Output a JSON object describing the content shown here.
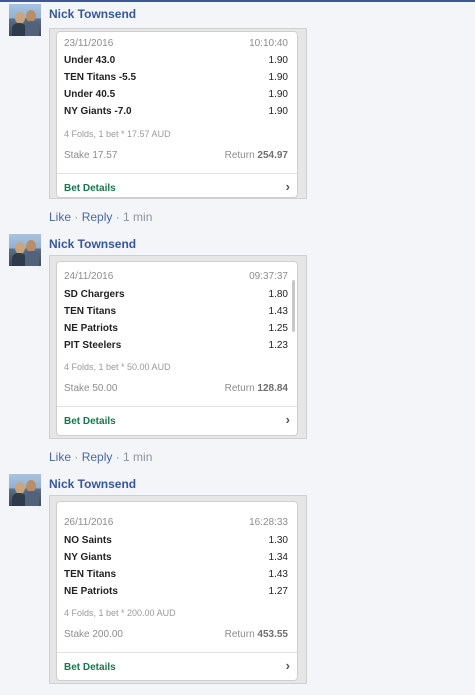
{
  "posts": [
    {
      "author": "Nick Townsend",
      "date": "23/11/2016",
      "time": "10:10:40",
      "legs": [
        {
          "team": "Under 43.0",
          "odds": "1.90"
        },
        {
          "team": "TEN Titans -5.5",
          "odds": "1.90"
        },
        {
          "team": "Under 40.5",
          "odds": "1.90"
        },
        {
          "team": "NY Giants -7.0",
          "odds": "1.90"
        }
      ],
      "summary": "4 Folds, 1 bet * 17.57 AUD",
      "stake": "Stake 17.57",
      "return_label": "Return",
      "return_value": "254.97",
      "details": "Bet Details",
      "like": "Like",
      "reply": "Reply",
      "age": "1 min"
    },
    {
      "author": "Nick Townsend",
      "date": "24/11/2016",
      "time": "09:37:37",
      "legs": [
        {
          "team": "SD Chargers",
          "odds": "1.80"
        },
        {
          "team": "TEN Titans",
          "odds": "1.43"
        },
        {
          "team": "NE Patriots",
          "odds": "1.25"
        },
        {
          "team": "PIT Steelers",
          "odds": "1.23"
        }
      ],
      "summary": "4 Folds, 1 bet * 50.00 AUD",
      "stake": "Stake 50.00",
      "return_label": "Return",
      "return_value": "128.84",
      "details": "Bet Details",
      "like": "Like",
      "reply": "Reply",
      "age": "1 min"
    },
    {
      "author": "Nick Townsend",
      "date": "26/11/2016",
      "time": "16:28:33",
      "legs": [
        {
          "team": "NO Saints",
          "odds": "1.30"
        },
        {
          "team": "NY Giants",
          "odds": "1.34"
        },
        {
          "team": "TEN Titans",
          "odds": "1.43"
        },
        {
          "team": "NE Patriots",
          "odds": "1.27"
        }
      ],
      "summary": "4 Folds, 1 bet * 200.00 AUD",
      "stake": "Stake 200.00",
      "return_label": "Return",
      "return_value": "453.55",
      "details": "Bet Details"
    }
  ],
  "separator": " · ",
  "icons": {
    "chevron": "chevron-right-icon"
  },
  "colors": {
    "name": "#365899",
    "details": "#17774c",
    "link": "#4b67a1",
    "topline": "#3b5998"
  }
}
